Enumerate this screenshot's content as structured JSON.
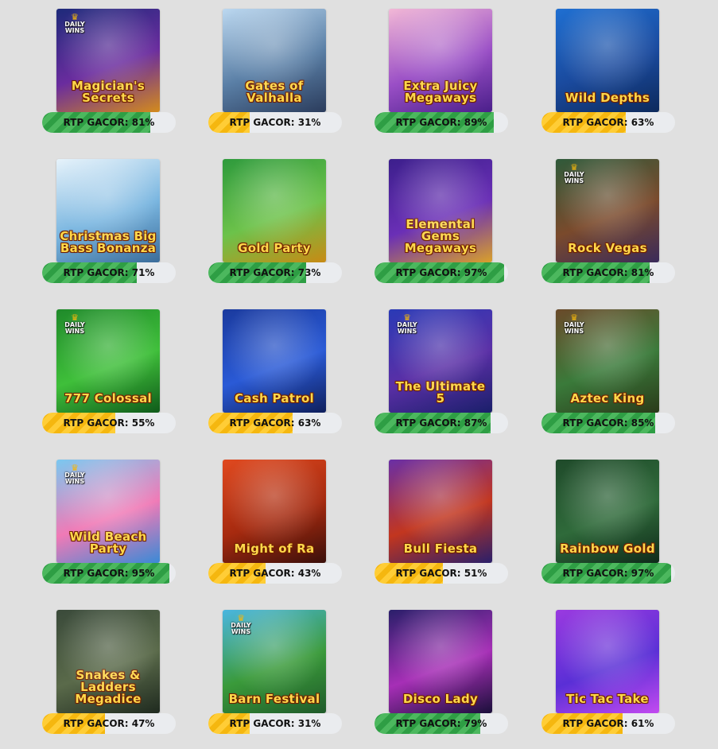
{
  "rtp_prefix": "RTP GACOR: ",
  "badge_text": "DAILY WINS",
  "colors": {
    "high_bar": "#2e9e44",
    "mid_bar": "#f5b70f",
    "track": "#eaecef",
    "background": "#e0e0e0"
  },
  "games": [
    {
      "title": "Magician's Secrets",
      "rtp": 81,
      "rtp_label": "RTP GACOR: 81%",
      "daily_wins": true,
      "bg": [
        "#1d2a7a",
        "#6a2c9e",
        "#d38b1c"
      ]
    },
    {
      "title": "Gates of Valhalla",
      "rtp": 31,
      "rtp_label": "RTP GACOR: 31%",
      "daily_wins": false,
      "bg": [
        "#bcd8f0",
        "#5a7fa6",
        "#2b3c5c"
      ]
    },
    {
      "title": "Extra Juicy Megaways",
      "rtp": 89,
      "rtp_label": "RTP GACOR: 89%",
      "daily_wins": false,
      "bg": [
        "#f2b8d6",
        "#9a4fc6",
        "#4a1f8a"
      ]
    },
    {
      "title": "Wild Depths",
      "rtp": 63,
      "rtp_label": "RTP GACOR: 63%",
      "daily_wins": false,
      "bg": [
        "#1f6fd1",
        "#1a4a9e",
        "#0d2a5c"
      ]
    },
    {
      "title": "Christmas Big Bass Bonanza",
      "rtp": 71,
      "rtp_label": "RTP GACOR: 71%",
      "daily_wins": false,
      "bg": [
        "#e7f3fb",
        "#7ab6e0",
        "#3a6c9a"
      ]
    },
    {
      "title": "Gold Party",
      "rtp": 73,
      "rtp_label": "RTP GACOR: 73%",
      "daily_wins": false,
      "bg": [
        "#2e9a3c",
        "#6cc24a",
        "#c88a14"
      ]
    },
    {
      "title": "Elemental Gems Megaways",
      "rtp": 97,
      "rtp_label": "RTP GACOR: 97%",
      "daily_wins": false,
      "bg": [
        "#3c1f8c",
        "#6a2fb6",
        "#d9a02a"
      ]
    },
    {
      "title": "Rock Vegas",
      "rtp": 81,
      "rtp_label": "RTP GACOR: 81%",
      "daily_wins": true,
      "bg": [
        "#2f5a3a",
        "#7a4a2c",
        "#3a2a5a"
      ]
    },
    {
      "title": "777 Colossal",
      "rtp": 55,
      "rtp_label": "RTP GACOR: 55%",
      "daily_wins": true,
      "bg": [
        "#1f8a2a",
        "#3fbf3a",
        "#0f5a1a"
      ]
    },
    {
      "title": "Cash Patrol",
      "rtp": 63,
      "rtp_label": "RTP GACOR: 63%",
      "daily_wins": false,
      "bg": [
        "#1a3a9e",
        "#2a5ad6",
        "#0f1f5c"
      ]
    },
    {
      "title": "The Ultimate 5",
      "rtp": 87,
      "rtp_label": "RTP GACOR: 87%",
      "daily_wins": true,
      "bg": [
        "#2a3ab6",
        "#5a2fa6",
        "#1a1f6a"
      ]
    },
    {
      "title": "Aztec King",
      "rtp": 85,
      "rtp_label": "RTP GACOR: 85%",
      "daily_wins": true,
      "bg": [
        "#6a4a2a",
        "#3a7a3a",
        "#2a3a1a"
      ]
    },
    {
      "title": "Wild Beach Party",
      "rtp": 95,
      "rtp_label": "RTP GACOR: 95%",
      "daily_wins": true,
      "bg": [
        "#7ac8f0",
        "#f07ab6",
        "#3a8ad6"
      ]
    },
    {
      "title": "Might of Ra",
      "rtp": 43,
      "rtp_label": "RTP GACOR: 43%",
      "daily_wins": false,
      "bg": [
        "#e0491f",
        "#a62a0f",
        "#3a0f0a"
      ]
    },
    {
      "title": "Bull Fiesta",
      "rtp": 51,
      "rtp_label": "RTP GACOR: 51%",
      "daily_wins": false,
      "bg": [
        "#6a2fa6",
        "#c2361f",
        "#2a1f6a"
      ]
    },
    {
      "title": "Rainbow Gold",
      "rtp": 97,
      "rtp_label": "RTP GACOR: 97%",
      "daily_wins": false,
      "bg": [
        "#1f4a2a",
        "#2f6a3a",
        "#0f2a1a"
      ]
    },
    {
      "title": "Snakes & Ladders Megadice",
      "rtp": 47,
      "rtp_label": "RTP GACOR: 47%",
      "daily_wins": false,
      "bg": [
        "#3a4a3a",
        "#5a6a4a",
        "#1f2a1f"
      ]
    },
    {
      "title": "Barn Festival",
      "rtp": 31,
      "rtp_label": "RTP GACOR: 31%",
      "daily_wins": true,
      "bg": [
        "#4ab6e0",
        "#3a9a3a",
        "#1f5a2a"
      ]
    },
    {
      "title": "Disco Lady",
      "rtp": 79,
      "rtp_label": "RTP GACOR: 79%",
      "daily_wins": false,
      "bg": [
        "#2a1f6a",
        "#a62fb6",
        "#1a0f3a"
      ]
    },
    {
      "title": "Tic Tac Take",
      "rtp": 61,
      "rtp_label": "RTP GACOR: 61%",
      "daily_wins": false,
      "bg": [
        "#9a3ae0",
        "#5a2fd6",
        "#c24af0"
      ]
    }
  ]
}
